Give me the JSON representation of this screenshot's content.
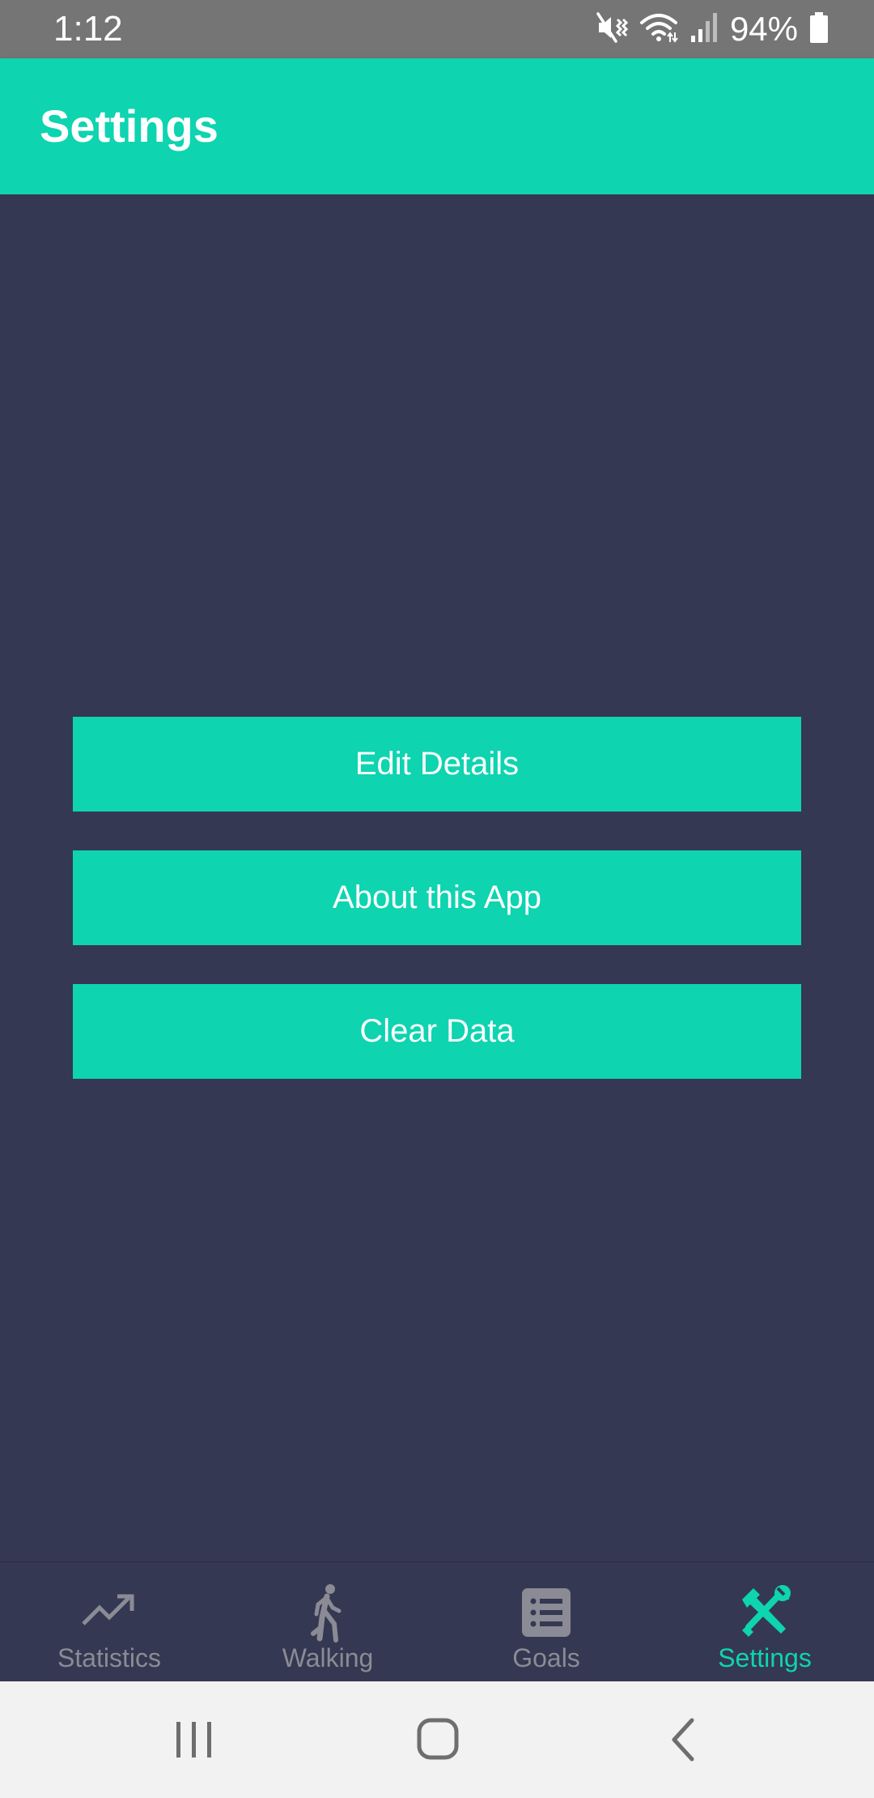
{
  "status_bar": {
    "time": "1:12",
    "battery_percent": "94%",
    "icons": [
      "mute-vibrate-icon",
      "wifi-icon",
      "signal-icon",
      "battery-icon"
    ]
  },
  "app_bar": {
    "title": "Settings"
  },
  "actions": {
    "edit_details": "Edit Details",
    "about_app": "About this App",
    "clear_data": "Clear Data"
  },
  "bottom_nav": {
    "items": [
      {
        "label": "Statistics",
        "icon": "trending-up-icon",
        "active": false
      },
      {
        "label": "Walking",
        "icon": "walking-icon",
        "active": false
      },
      {
        "label": "Goals",
        "icon": "list-icon",
        "active": false
      },
      {
        "label": "Settings",
        "icon": "tools-icon",
        "active": true
      }
    ]
  },
  "system_nav": {
    "buttons": [
      "recents-icon",
      "home-icon",
      "back-icon"
    ]
  },
  "colors": {
    "accent": "#0ed4b0",
    "background": "#353852",
    "status_bar": "#757575",
    "inactive": "#8a8b94",
    "system_nav": "#f2f2f2"
  }
}
